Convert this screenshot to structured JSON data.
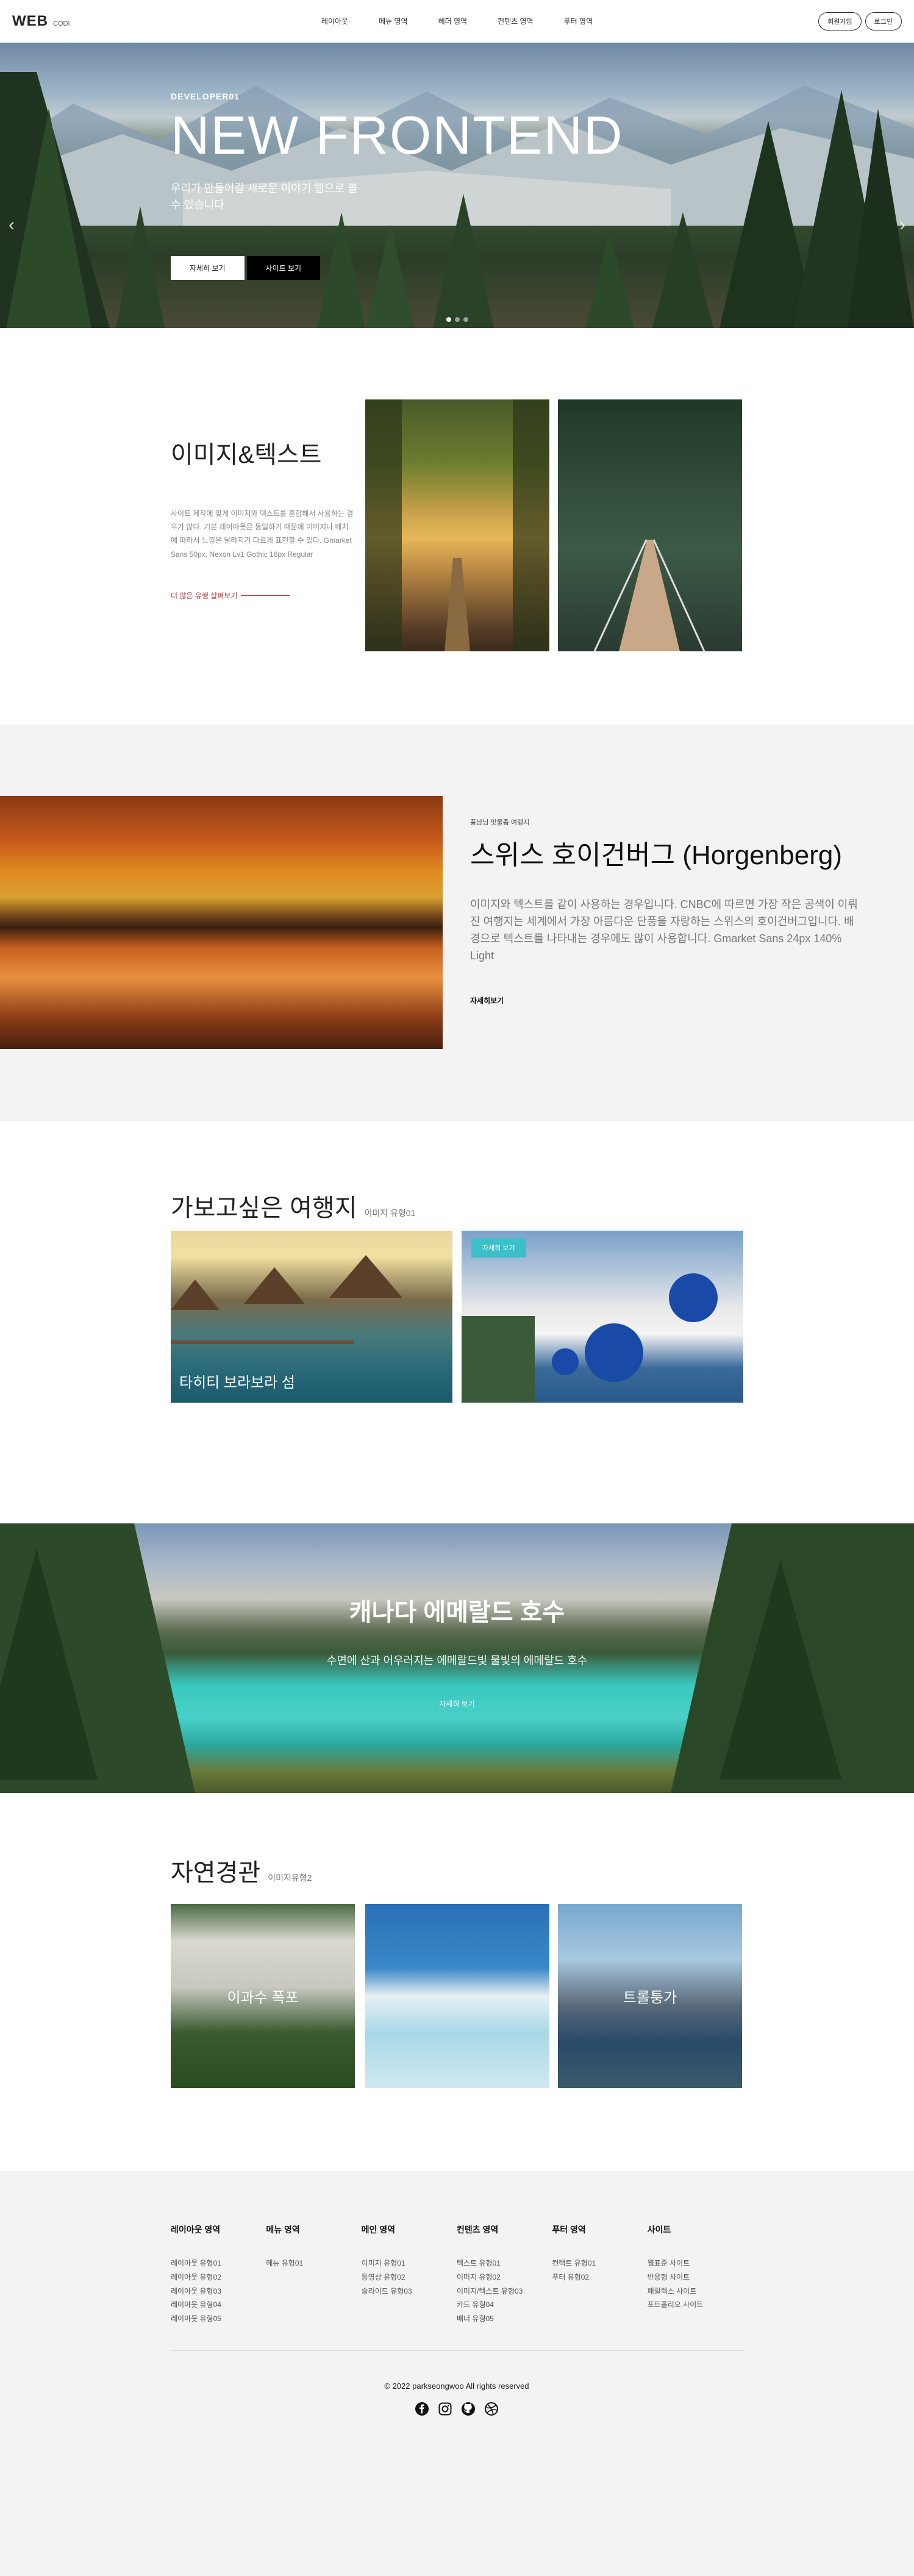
{
  "header": {
    "logo": "WEB",
    "logo_sub": "CODI",
    "nav": [
      "레이아웃",
      "메뉴 영역",
      "헤더 영역",
      "컨텐츠 영역",
      "푸터 영역"
    ],
    "signup": "회원가입",
    "login": "로그인"
  },
  "hero": {
    "eyebrow": "DEVELOPER01",
    "title": "NEW FRONTEND",
    "desc": "우리가 만들어갈 새로운 이야기 웹으로 볼 수 있습니다.",
    "btn_detail": "자세히 보기",
    "btn_site": "사이트 보기"
  },
  "imgtext": {
    "title": "이미지&텍스트",
    "desc": "사이트 제작에 맞게 이미지와 텍스트를 혼합해서 사용하는 경우가 많다. 기본 레이아웃은 동일하기 때문에 이미지나 배치에 따라서 느낌은 달라지기 다르게 표현할 수 있다. Gmarket Sans 50px. Nexon Lv1 Gothic 16px Regular",
    "more": "더 많은 유행 살펴보기"
  },
  "swiss": {
    "eyebrow": "풍남님 맛울좀 여행지",
    "title": "스위스 호이건버그 (Horgenberg)",
    "desc": "이미지와 텍스트를 같이 사용하는 경우입니다. CNBC에 따르면 가장 작은 공색이 이뤄진 여행지는 세계에서 가장 아름다운 단풍을 자랑하는 스위스의 호이건버그입니다. 배경으로 텍스트를 나타내는 경우에도 많이 사용합니다. Gmarket Sans 24px 140% Light",
    "link": "자세히보기"
  },
  "travel": {
    "title": "가보고싶은 여행지",
    "sub": "이미지 유형01",
    "card1_caption": "타히티 보라보라 섬",
    "card2_badge": "자세히 보기"
  },
  "canada": {
    "title": "캐나다 에메랄드 호수",
    "desc": "수면에 산과 어우러지는 에메랄드빛 물빛의 에메랄드 호수",
    "link": "자세히 보기"
  },
  "nature": {
    "title": "자연경관",
    "sub": "이미지유형2",
    "card1": "이과수 폭포",
    "card2": "",
    "card3": "트롤퉁가"
  },
  "footer": {
    "columns": [
      {
        "title": "레이아웃 영역",
        "items": [
          "레이아웃 유형01",
          "레이아웃 유형02",
          "레이아웃 유형03",
          "레이아웃 유형04",
          "레이아웃 유형05"
        ]
      },
      {
        "title": "메뉴 영역",
        "items": [
          "메뉴 유형01"
        ]
      },
      {
        "title": "메인 영역",
        "items": [
          "이미지 유형01",
          "동영상 유형02",
          "슬라이드 유형03"
        ]
      },
      {
        "title": "컨텐츠 영역",
        "items": [
          "텍스트 유형01",
          "이미지 유형02",
          "이미지/텍스트 유형03",
          "카드 유형04",
          "배너 유형05"
        ]
      },
      {
        "title": "푸터 영역",
        "items": [
          "컨택트 유형01",
          "푸터 유형02"
        ]
      },
      {
        "title": "사이트",
        "items": [
          "웹표준 사이트",
          "반응형 사이트",
          "패럴렉스 사이트",
          "포트폴리오 사이트"
        ]
      }
    ],
    "copyright": "© 2022 parkseongwoo All rights reserved"
  }
}
